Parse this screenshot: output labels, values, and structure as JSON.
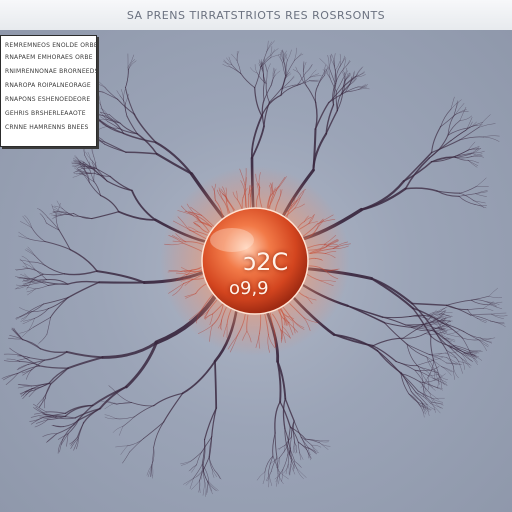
{
  "header": {
    "title": "SA PRENS TIRRATSTRIOTS RES ROSRSONTS"
  },
  "info_panel": {
    "lines": [
      "REMREMNEOS ENOLDE ORBE",
      "RNAPAEM EMHORAES ORBE",
      "RNIMRENNONAE BRORNEEDS",
      "RNAROPA ROIPALNEORAGE",
      "RNAPONS ESHENOEDEORE",
      "GEHRIS BRSHERLEAAOTE",
      "CRNNE HAMRENNS BNEES"
    ]
  },
  "orb": {
    "label_top": "ɔ2C",
    "label_bottom": "o9,9"
  },
  "colors": {
    "background": "#9ba4b7",
    "orb_core": "#f06b3c",
    "orb_glow": "#ff9a66",
    "veins": "#3a2840"
  }
}
